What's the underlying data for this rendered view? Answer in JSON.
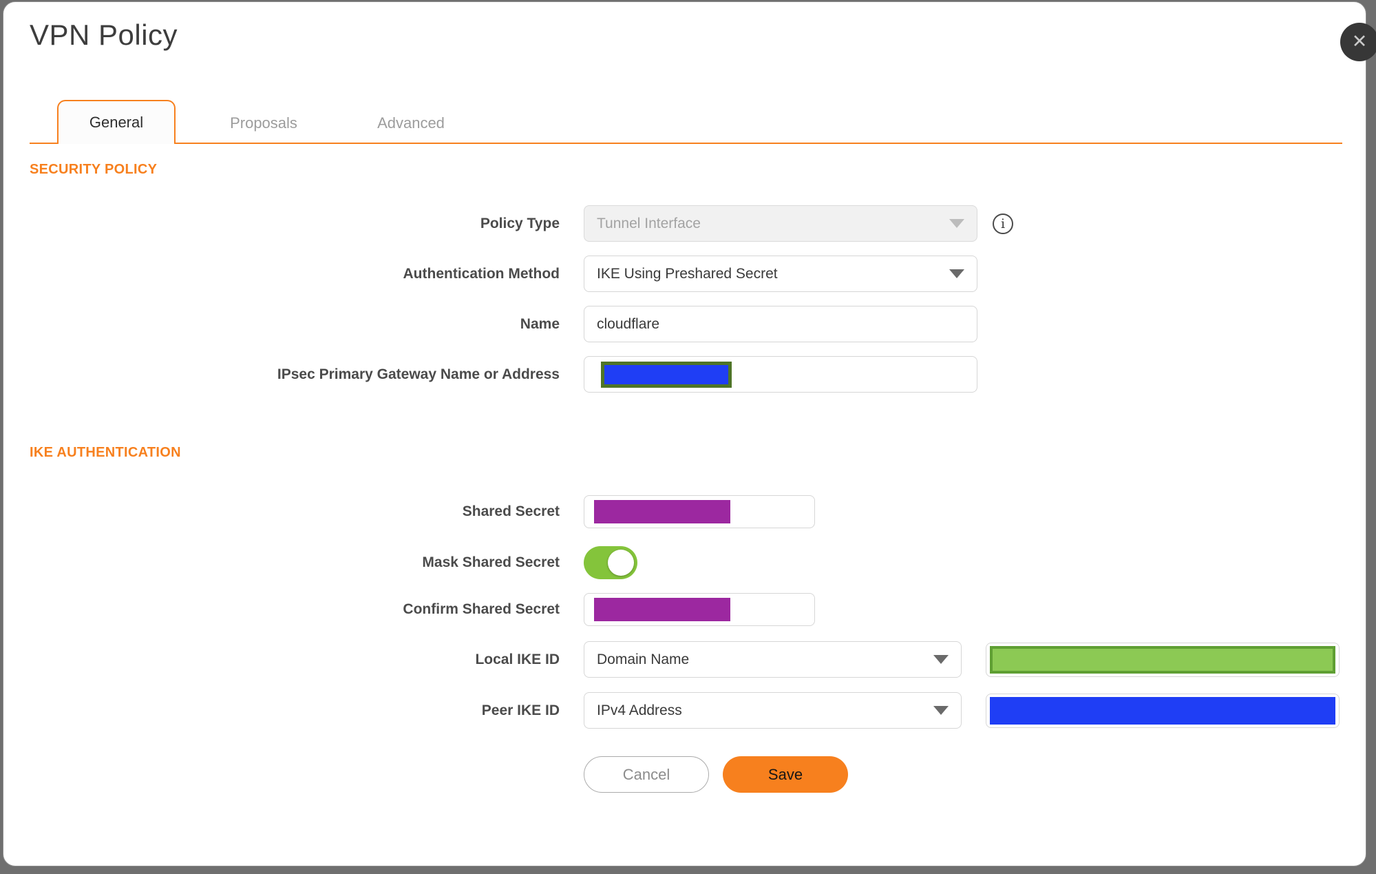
{
  "colors": {
    "accent": "#f7801e",
    "backdrop": "#6f6f6f",
    "toggle-green": "#84c43b",
    "redact-purple": "#9c28a0",
    "redact-blue": "#1f3ef5",
    "redact-green": "#8cc954",
    "redact-green-border": "#5f9f33",
    "redact-olive-border": "#4f7527"
  },
  "dialog": {
    "title": "VPN Policy",
    "close_glyph": "✕"
  },
  "tabs": [
    {
      "label": "General",
      "active": true
    },
    {
      "label": "Proposals",
      "active": false
    },
    {
      "label": "Advanced",
      "active": false
    }
  ],
  "security_policy": {
    "heading": "SECURITY POLICY",
    "policy_type": {
      "label": "Policy Type",
      "value": "Tunnel Interface",
      "disabled": true,
      "info_icon_glyph": "i"
    },
    "authentication_method": {
      "label": "Authentication Method",
      "value": "IKE Using Preshared Secret"
    },
    "name": {
      "label": "Name",
      "value": "cloudflare"
    },
    "gateway": {
      "label": "IPsec Primary Gateway Name or Address",
      "value_redacted": true
    }
  },
  "ike_authentication": {
    "heading": "IKE AUTHENTICATION",
    "shared_secret": {
      "label": "Shared Secret",
      "value_redacted": true
    },
    "mask_shared_secret": {
      "label": "Mask Shared Secret",
      "state": "on"
    },
    "confirm_shared_secret": {
      "label": "Confirm Shared Secret",
      "value_redacted": true
    },
    "local_ike_id": {
      "label": "Local IKE ID",
      "value": "Domain Name",
      "id_value_redacted": true
    },
    "peer_ike_id": {
      "label": "Peer IKE ID",
      "value": "IPv4 Address",
      "id_value_redacted": true
    }
  },
  "buttons": {
    "cancel": "Cancel",
    "save": "Save"
  }
}
